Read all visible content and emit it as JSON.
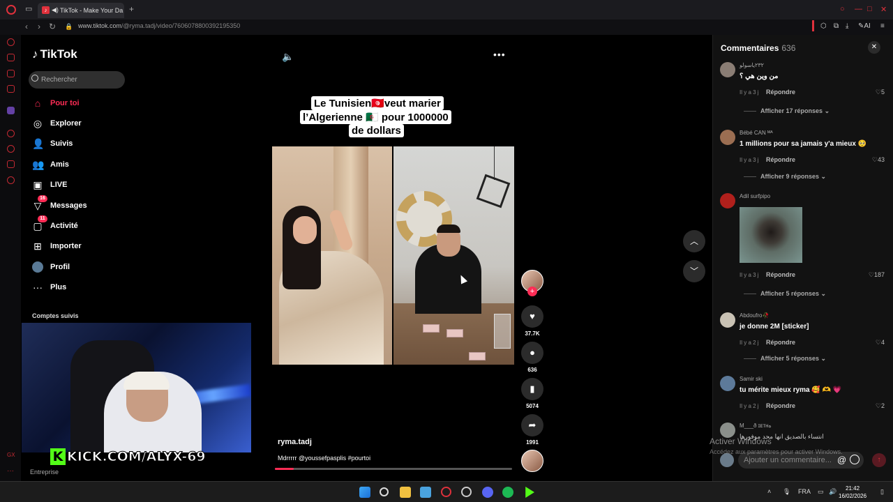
{
  "browser": {
    "tab_title": "TikTok - Make Your Da",
    "url_host": "www.tiktok.com",
    "url_path": "/@ryma.tadj/video/7606078800392195350",
    "ai_label": "AI"
  },
  "tiktok": {
    "logo": "TikTok",
    "search_placeholder": "Rechercher",
    "nav": [
      {
        "label": "Pour toi",
        "icon": "home-icon",
        "active": true
      },
      {
        "label": "Explorer",
        "icon": "compass-icon"
      },
      {
        "label": "Suivis",
        "icon": "following-icon"
      },
      {
        "label": "Amis",
        "icon": "friends-icon"
      },
      {
        "label": "LIVE",
        "icon": "live-icon"
      },
      {
        "label": "Messages",
        "icon": "messages-icon",
        "badge": "16"
      },
      {
        "label": "Activité",
        "icon": "activity-icon",
        "badge": "11"
      },
      {
        "label": "Importer",
        "icon": "upload-icon"
      },
      {
        "label": "Profil",
        "icon": "profile-icon"
      },
      {
        "label": "Plus",
        "icon": "more-icon"
      }
    ],
    "followed_title": "Comptes suivis",
    "footer": "Entreprise"
  },
  "overlay": {
    "kick_text": "KICK.COM/ALYX-69",
    "kick_letter": "K"
  },
  "video": {
    "caption_lines": [
      "Le Tunisien🇹🇳veut marier",
      "l’Algerienne 🇩🇿 pour 1000000",
      "de dollars"
    ],
    "author": "ryma.tadj",
    "description": "Mdrrrrr @youssefpasplis #pourtoi",
    "progress": 0.08,
    "likes": "37.7K",
    "comments": "636",
    "saves": "5074",
    "shares": "1991"
  },
  "comments": {
    "title": "Commentaires",
    "count": "636",
    "input_placeholder": "Ajouter un commentaire...",
    "reply_label": "Répondre",
    "items": [
      {
        "name": "٢٣٢ياسولو",
        "text": "من وين هي ؟",
        "meta": "Il y a 3 j",
        "likes": "5",
        "more": "Afficher 17 réponses"
      },
      {
        "name": "Bébé CAN ᴹᴬ",
        "text": "1 millions pour sa jamais y'a mieux 🥺",
        "meta": "Il y a 3 j",
        "likes": "43",
        "more": "Afficher 9 réponses"
      },
      {
        "name": "Adil surfpipo",
        "text": "",
        "meta": "Il y a 3 j",
        "likes": "187",
        "more": "Afficher 5 réponses"
      },
      {
        "name": "Abdoufro🥀",
        "text": "je donne 2M [sticker]",
        "meta": "Il y a 2 j",
        "likes": "4",
        "more": "Afficher 5 réponses"
      },
      {
        "name": "Samir ski",
        "text": "tu mérite mieux ryma 🥰 🫶 💗",
        "meta": "Il y a 2 j",
        "likes": "2",
        "more": ""
      },
      {
        "name": "M⁠___ð ɪᴇᴛʜه",
        "text": "انتساء بالصديق انها محد موفورها",
        "meta": "",
        "likes": "",
        "more": ""
      }
    ]
  },
  "windows": {
    "activate_title": "Activer Windows",
    "activate_sub": "Accédez aux paramètres pour activer Windows.",
    "lang": "FRA",
    "time": "21:42",
    "date": "16/02/2026"
  },
  "colors": {
    "tiktok_red": "#fe2c55",
    "opera_red": "#e0313c",
    "kick_green": "#53fc18"
  }
}
